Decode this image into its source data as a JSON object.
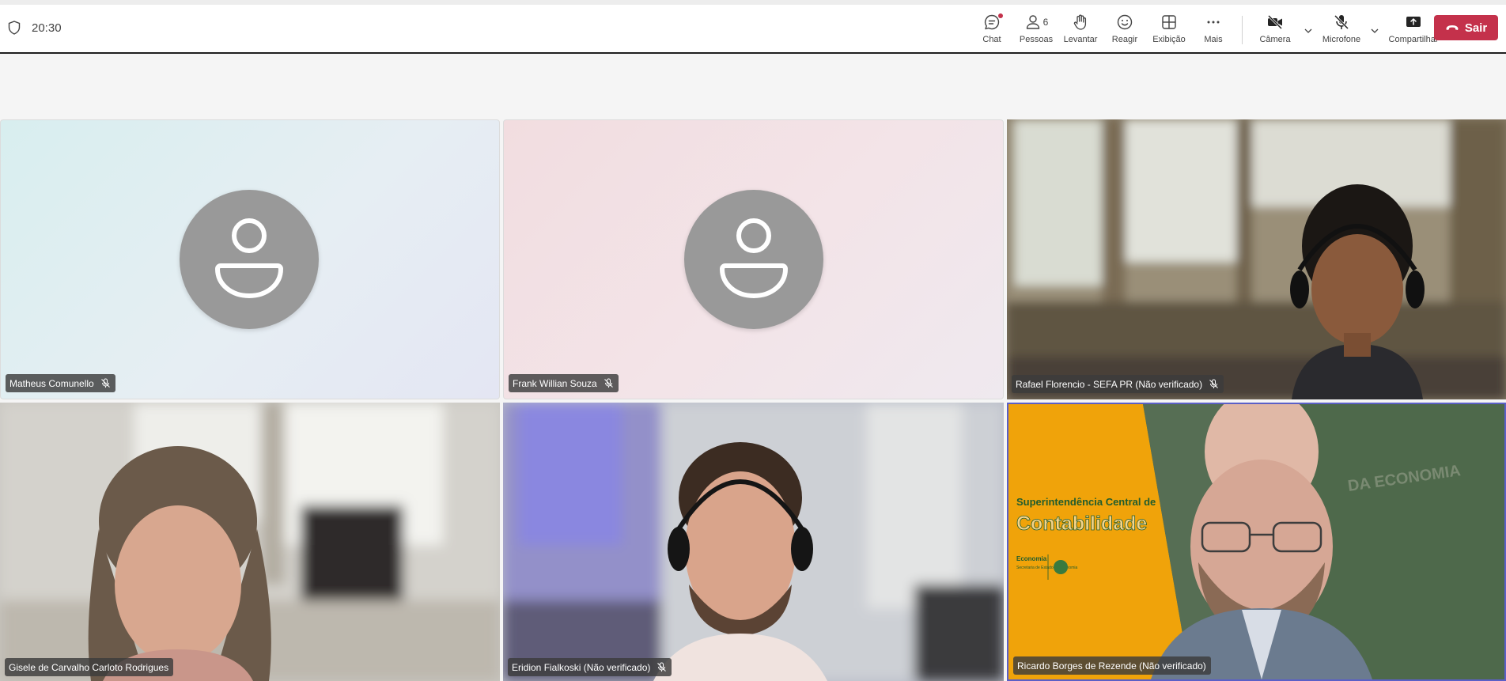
{
  "meeting": {
    "timer": "20:30"
  },
  "toolbar": {
    "chat_label": "Chat",
    "people_label": "Pessoas",
    "people_count": "6",
    "raise_label": "Levantar",
    "react_label": "Reagir",
    "view_label": "Exibição",
    "more_label": "Mais",
    "camera_label": "Câmera",
    "mic_label": "Microfone",
    "share_label": "Compartilhar",
    "leave_label": "Sair"
  },
  "participants": [
    {
      "name": "Matheus Comunello",
      "muted": true,
      "video": false
    },
    {
      "name": "Frank Willian Souza",
      "muted": true,
      "video": false
    },
    {
      "name": "Rafael Florencio - SEFA PR (Não verificado)",
      "muted": true,
      "video": true
    },
    {
      "name": "Gisele de Carvalho Carloto Rodrigues",
      "muted": false,
      "video": true
    },
    {
      "name": "Eridion Fialkoski (Não verificado)",
      "muted": true,
      "video": true
    },
    {
      "name": "Ricardo Borges de Rezende (Não verificado)",
      "muted": false,
      "video": true,
      "speaking": true
    }
  ],
  "backgrounds": {
    "ricardo_banner": {
      "line1": "Superintendência Central de",
      "line2": "Contabilidade",
      "logo_title": "Economia",
      "logo_sub": "Secretaria de Estado da Economia",
      "wall_text": "DA ECONOMIA"
    }
  },
  "colors": {
    "leave_button": "#c4314b",
    "active_speaker_border": "#5b5fc7",
    "avatar_gray": "#999999",
    "banner_orange": "#f0a30a",
    "banner_green": "#1f5c2e"
  }
}
